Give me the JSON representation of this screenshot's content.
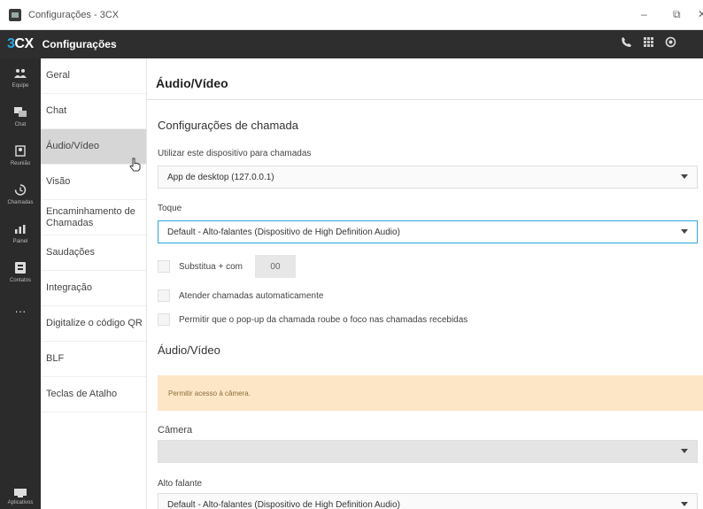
{
  "window": {
    "title": "Configurações - 3CX",
    "minimize": "–",
    "maximize": "⧉",
    "close": "✕"
  },
  "appbar": {
    "logo_prefix": "3",
    "logo_suffix": "CX",
    "title": "Configurações"
  },
  "rail": {
    "items": [
      {
        "label": "Equipe",
        "icon": "team-icon"
      },
      {
        "label": "Chat",
        "icon": "chat-icon"
      },
      {
        "label": "Reunião",
        "icon": "meeting-icon"
      },
      {
        "label": "Chamadas",
        "icon": "calls-icon"
      },
      {
        "label": "Painel",
        "icon": "panel-icon"
      },
      {
        "label": "Contatos",
        "icon": "contacts-icon"
      },
      {
        "label": "···",
        "icon": "more-icon"
      }
    ],
    "bottom": {
      "label": "Aplicativos",
      "icon": "apps-icon"
    }
  },
  "menu": {
    "items": [
      {
        "label": "Geral"
      },
      {
        "label": "Chat"
      },
      {
        "label": "Áudio/Vídeo"
      },
      {
        "label": "Visão"
      },
      {
        "label": "Encaminhamento de Chamadas"
      },
      {
        "label": "Saudações"
      },
      {
        "label": "Integração"
      },
      {
        "label": "Digitalize o código QR"
      },
      {
        "label": "BLF"
      },
      {
        "label": "Teclas de Atalho"
      }
    ],
    "active_index": 2
  },
  "main": {
    "title": "Áudio/Vídeo",
    "call_section": "Configurações de chamada",
    "device_label": "Utilizar este dispositivo para chamadas",
    "device_value": "App de desktop (127.0.0.1)",
    "ring_label": "Toque",
    "ring_value": "Default - Alto-falantes (Dispositivo de High Definition Audio)",
    "replace_label": "Substitua + com",
    "replace_value": "00",
    "auto_answer_label": "Atender chamadas automaticamente",
    "popup_focus_label": "Permitir que o pop-up da chamada roube o foco nas chamadas recebidas",
    "av_section": "Áudio/Vídeo",
    "camera_warning": "Permitir acesso à câmera.",
    "camera_label": "Câmera",
    "camera_value": "",
    "speaker_label": "Alto falante",
    "speaker_value": "Default - Alto-falantes (Dispositivo de High Definition Audio)"
  },
  "colors": {
    "accent": "#2aa7e0",
    "header": "#2e2e2e",
    "warning_bg": "#fde6c6"
  }
}
